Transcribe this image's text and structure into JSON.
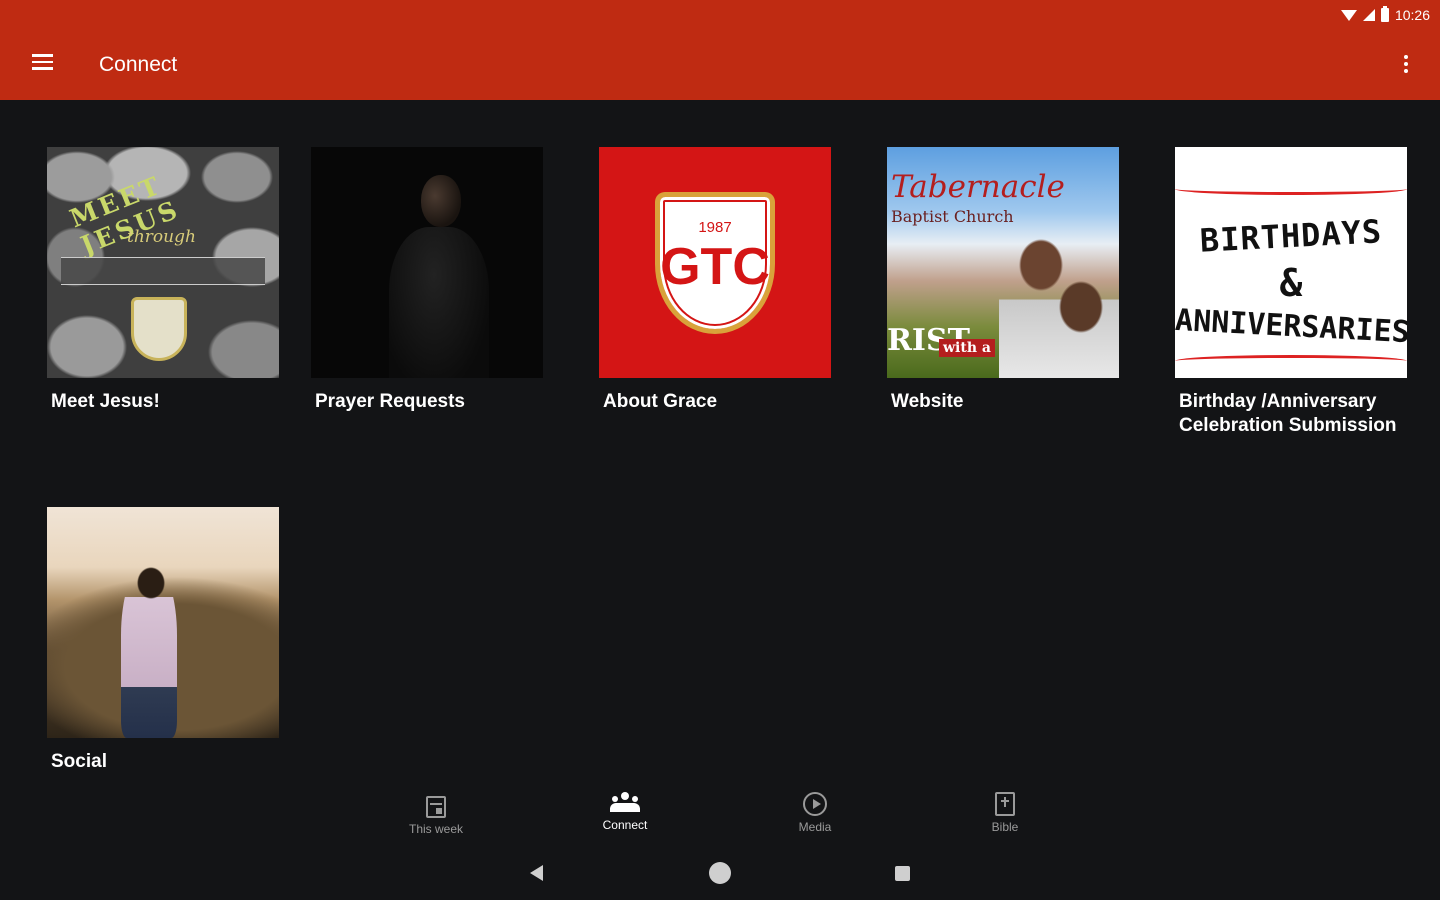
{
  "status_bar": {
    "time": "10:26"
  },
  "app_bar": {
    "title": "Connect",
    "menu_icon": "hamburger-menu-icon",
    "overflow_icon": "more-vert-icon"
  },
  "colors": {
    "app_bar": "#bf2b12",
    "background": "#131416",
    "about_grace_bg": "#d41515"
  },
  "tiles": [
    {
      "label": "Meet Jesus!",
      "art": {
        "arc": "MEET JESUS",
        "script": "through"
      }
    },
    {
      "label": "Prayer Requests"
    },
    {
      "label": "About Grace",
      "art": {
        "letters": "GTC",
        "year": "1987"
      }
    },
    {
      "label": "Website",
      "art": {
        "title": "Tabernacle",
        "subtitle": "Baptist Church",
        "christ": "RIST",
        "with": "with a"
      }
    },
    {
      "label": "Birthday /Anniversary Celebration Submission",
      "art": {
        "line1": "BIRTHDAYS",
        "line2": "&",
        "line3": "ANNIVERSARIES"
      }
    },
    {
      "label": "Social"
    }
  ],
  "bottom_nav": [
    {
      "label": "This week",
      "icon": "calendar-icon",
      "active": false
    },
    {
      "label": "Connect",
      "icon": "people-icon",
      "active": true
    },
    {
      "label": "Media",
      "icon": "play-circle-icon",
      "active": false
    },
    {
      "label": "Bible",
      "icon": "book-icon",
      "active": false
    }
  ],
  "system_nav": {
    "back_icon": "back-triangle-icon",
    "home_icon": "home-circle-icon",
    "recents_icon": "recents-square-icon"
  }
}
